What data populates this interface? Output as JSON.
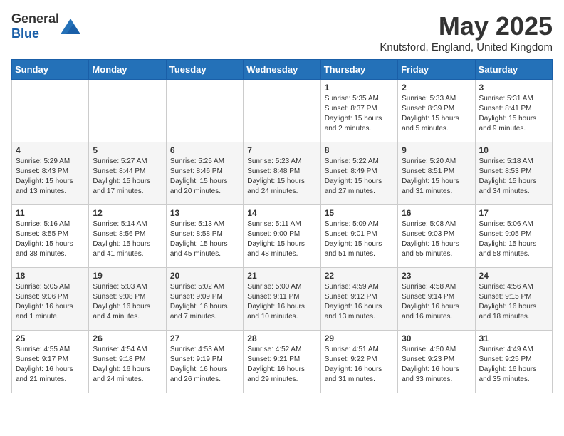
{
  "header": {
    "logo_general": "General",
    "logo_blue": "Blue",
    "month_year": "May 2025",
    "location": "Knutsford, England, United Kingdom"
  },
  "weekdays": [
    "Sunday",
    "Monday",
    "Tuesday",
    "Wednesday",
    "Thursday",
    "Friday",
    "Saturday"
  ],
  "rows": [
    [
      {
        "day": "",
        "info": ""
      },
      {
        "day": "",
        "info": ""
      },
      {
        "day": "",
        "info": ""
      },
      {
        "day": "",
        "info": ""
      },
      {
        "day": "1",
        "info": "Sunrise: 5:35 AM\nSunset: 8:37 PM\nDaylight: 15 hours\nand 2 minutes."
      },
      {
        "day": "2",
        "info": "Sunrise: 5:33 AM\nSunset: 8:39 PM\nDaylight: 15 hours\nand 5 minutes."
      },
      {
        "day": "3",
        "info": "Sunrise: 5:31 AM\nSunset: 8:41 PM\nDaylight: 15 hours\nand 9 minutes."
      }
    ],
    [
      {
        "day": "4",
        "info": "Sunrise: 5:29 AM\nSunset: 8:43 PM\nDaylight: 15 hours\nand 13 minutes."
      },
      {
        "day": "5",
        "info": "Sunrise: 5:27 AM\nSunset: 8:44 PM\nDaylight: 15 hours\nand 17 minutes."
      },
      {
        "day": "6",
        "info": "Sunrise: 5:25 AM\nSunset: 8:46 PM\nDaylight: 15 hours\nand 20 minutes."
      },
      {
        "day": "7",
        "info": "Sunrise: 5:23 AM\nSunset: 8:48 PM\nDaylight: 15 hours\nand 24 minutes."
      },
      {
        "day": "8",
        "info": "Sunrise: 5:22 AM\nSunset: 8:49 PM\nDaylight: 15 hours\nand 27 minutes."
      },
      {
        "day": "9",
        "info": "Sunrise: 5:20 AM\nSunset: 8:51 PM\nDaylight: 15 hours\nand 31 minutes."
      },
      {
        "day": "10",
        "info": "Sunrise: 5:18 AM\nSunset: 8:53 PM\nDaylight: 15 hours\nand 34 minutes."
      }
    ],
    [
      {
        "day": "11",
        "info": "Sunrise: 5:16 AM\nSunset: 8:55 PM\nDaylight: 15 hours\nand 38 minutes."
      },
      {
        "day": "12",
        "info": "Sunrise: 5:14 AM\nSunset: 8:56 PM\nDaylight: 15 hours\nand 41 minutes."
      },
      {
        "day": "13",
        "info": "Sunrise: 5:13 AM\nSunset: 8:58 PM\nDaylight: 15 hours\nand 45 minutes."
      },
      {
        "day": "14",
        "info": "Sunrise: 5:11 AM\nSunset: 9:00 PM\nDaylight: 15 hours\nand 48 minutes."
      },
      {
        "day": "15",
        "info": "Sunrise: 5:09 AM\nSunset: 9:01 PM\nDaylight: 15 hours\nand 51 minutes."
      },
      {
        "day": "16",
        "info": "Sunrise: 5:08 AM\nSunset: 9:03 PM\nDaylight: 15 hours\nand 55 minutes."
      },
      {
        "day": "17",
        "info": "Sunrise: 5:06 AM\nSunset: 9:05 PM\nDaylight: 15 hours\nand 58 minutes."
      }
    ],
    [
      {
        "day": "18",
        "info": "Sunrise: 5:05 AM\nSunset: 9:06 PM\nDaylight: 16 hours\nand 1 minute."
      },
      {
        "day": "19",
        "info": "Sunrise: 5:03 AM\nSunset: 9:08 PM\nDaylight: 16 hours\nand 4 minutes."
      },
      {
        "day": "20",
        "info": "Sunrise: 5:02 AM\nSunset: 9:09 PM\nDaylight: 16 hours\nand 7 minutes."
      },
      {
        "day": "21",
        "info": "Sunrise: 5:00 AM\nSunset: 9:11 PM\nDaylight: 16 hours\nand 10 minutes."
      },
      {
        "day": "22",
        "info": "Sunrise: 4:59 AM\nSunset: 9:12 PM\nDaylight: 16 hours\nand 13 minutes."
      },
      {
        "day": "23",
        "info": "Sunrise: 4:58 AM\nSunset: 9:14 PM\nDaylight: 16 hours\nand 16 minutes."
      },
      {
        "day": "24",
        "info": "Sunrise: 4:56 AM\nSunset: 9:15 PM\nDaylight: 16 hours\nand 18 minutes."
      }
    ],
    [
      {
        "day": "25",
        "info": "Sunrise: 4:55 AM\nSunset: 9:17 PM\nDaylight: 16 hours\nand 21 minutes."
      },
      {
        "day": "26",
        "info": "Sunrise: 4:54 AM\nSunset: 9:18 PM\nDaylight: 16 hours\nand 24 minutes."
      },
      {
        "day": "27",
        "info": "Sunrise: 4:53 AM\nSunset: 9:19 PM\nDaylight: 16 hours\nand 26 minutes."
      },
      {
        "day": "28",
        "info": "Sunrise: 4:52 AM\nSunset: 9:21 PM\nDaylight: 16 hours\nand 29 minutes."
      },
      {
        "day": "29",
        "info": "Sunrise: 4:51 AM\nSunset: 9:22 PM\nDaylight: 16 hours\nand 31 minutes."
      },
      {
        "day": "30",
        "info": "Sunrise: 4:50 AM\nSunset: 9:23 PM\nDaylight: 16 hours\nand 33 minutes."
      },
      {
        "day": "31",
        "info": "Sunrise: 4:49 AM\nSunset: 9:25 PM\nDaylight: 16 hours\nand 35 minutes."
      }
    ]
  ]
}
